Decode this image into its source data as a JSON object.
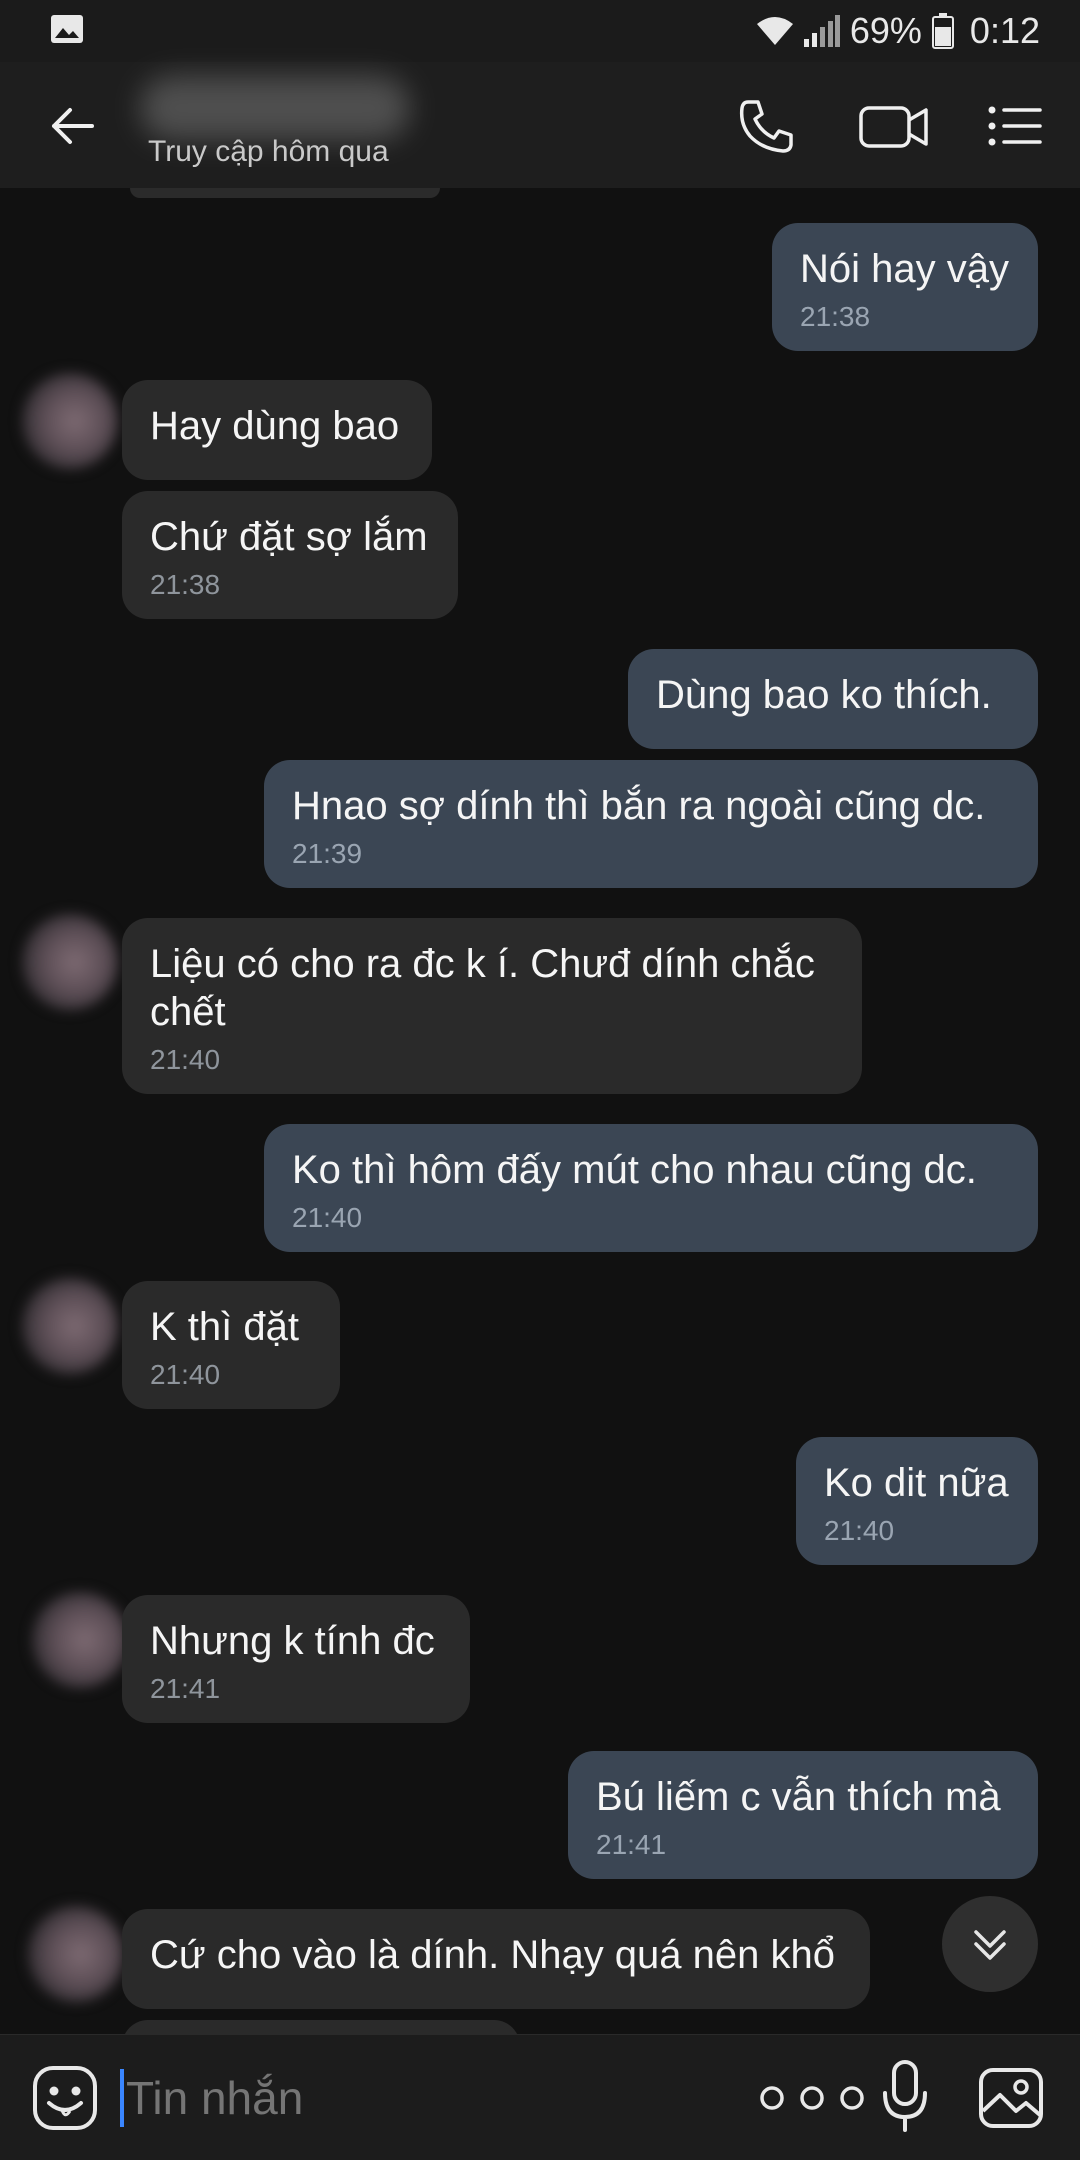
{
  "status_bar": {
    "battery": "69%",
    "time": "0:12",
    "icons": [
      "gallery-icon",
      "wifi-icon",
      "signal-icon",
      "battery-icon"
    ]
  },
  "header": {
    "last_seen": "Truy cập hôm qua",
    "icons": [
      "back-arrow-icon",
      "phone-icon",
      "video-camera-icon",
      "menu-icon"
    ]
  },
  "messages": [
    {
      "direction": "out",
      "text": "Nói hay vậy",
      "time": "21:38"
    },
    {
      "direction": "in",
      "text": "Hay dùng bao",
      "time": ""
    },
    {
      "direction": "in",
      "text": "Chứ đặt sợ lắm",
      "time": "21:38"
    },
    {
      "direction": "out",
      "text": "Dùng bao ko thích.",
      "time": ""
    },
    {
      "direction": "out",
      "text": "Hnao sợ dính thì bắn ra ngoài cũng dc.",
      "time": "21:39"
    },
    {
      "direction": "in",
      "text": "Liệu có cho ra đc k í. Chưđ dính chắc chết",
      "time": "21:40"
    },
    {
      "direction": "out",
      "text": "Ko thì hôm đấy mút cho nhau cũng dc.",
      "time": "21:40"
    },
    {
      "direction": "in",
      "text": "K thì đặt",
      "time": "21:40"
    },
    {
      "direction": "out",
      "text": "Ko dit nữa",
      "time": "21:40"
    },
    {
      "direction": "in",
      "text": "Nhưng k tính đc",
      "time": "21:41"
    },
    {
      "direction": "out",
      "text": "Bú liếm c vẫn thích mà",
      "time": "21:41"
    },
    {
      "direction": "in",
      "text": "Cứ cho vào là dính. Nhạy quá nên khổ",
      "time": ""
    }
  ],
  "input_bar": {
    "placeholder": "Tin nhắn",
    "icons": [
      "emoji-icon",
      "more-dots-icon",
      "microphone-icon",
      "image-icon"
    ]
  },
  "colors": {
    "background": "#111111",
    "incoming_bubble": "#2a2a2a",
    "outgoing_bubble": "#3b4654",
    "timestamp": "#8f959c",
    "caret": "#3a86ff"
  }
}
